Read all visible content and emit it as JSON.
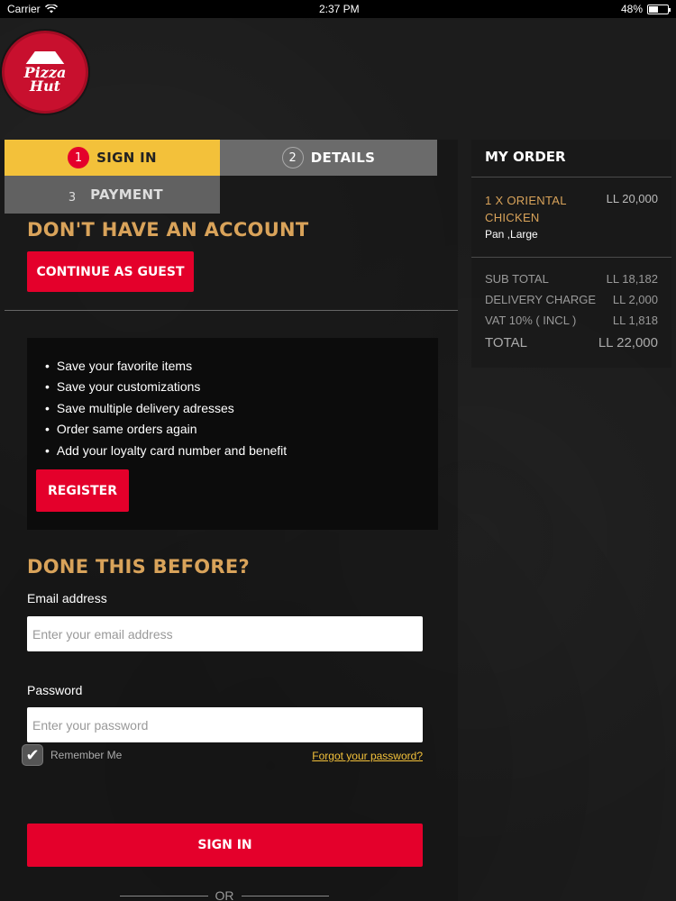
{
  "status_bar": {
    "carrier": "Carrier",
    "time": "2:37 PM",
    "battery_label": "48%",
    "battery_level": 0.48
  },
  "brand": {
    "logo_line1": "Pizza",
    "logo_line2": "Hut",
    "colors": {
      "red": "#e4002b",
      "gold": "#f3c13a",
      "heading": "#d9a35a"
    }
  },
  "steps": [
    {
      "num": "1",
      "label": "SIGN IN",
      "active": true
    },
    {
      "num": "2",
      "label": "DETAILS",
      "active": false
    },
    {
      "num": "3",
      "label": "PAYMENT",
      "active": false
    }
  ],
  "guest": {
    "heading": "DON'T HAVE AN ACCOUNT",
    "button": "CONTINUE AS GUEST"
  },
  "benefits": {
    "items": [
      "Save your favorite items",
      "Save your customizations",
      "Save multiple delivery adresses",
      "Order same orders again",
      "Add your loyalty card number and benefit"
    ],
    "register_button": "REGISTER"
  },
  "signin": {
    "heading": "DONE THIS BEFORE?",
    "email_label": "Email address",
    "email_placeholder": "Enter your email address",
    "password_label": "Password",
    "password_placeholder": "Enter your password",
    "remember_label": "Remember Me",
    "remember_checked": true,
    "forgot_link": "Forgot your password?",
    "button": "SIGN IN",
    "or_text": "OR"
  },
  "order": {
    "title": "MY ORDER",
    "item": {
      "name": "1 X ORIENTAL CHICKEN",
      "price": "LL 20,000",
      "desc": "Pan ,Large"
    },
    "summary": [
      {
        "label": "SUB TOTAL",
        "value": "LL 18,182"
      },
      {
        "label": "DELIVERY CHARGE",
        "value": "LL 2,000"
      },
      {
        "label": "VAT 10% ( INCL )",
        "value": "LL 1,818"
      }
    ],
    "total": {
      "label": "TOTAL",
      "value": "LL 22,000"
    }
  }
}
